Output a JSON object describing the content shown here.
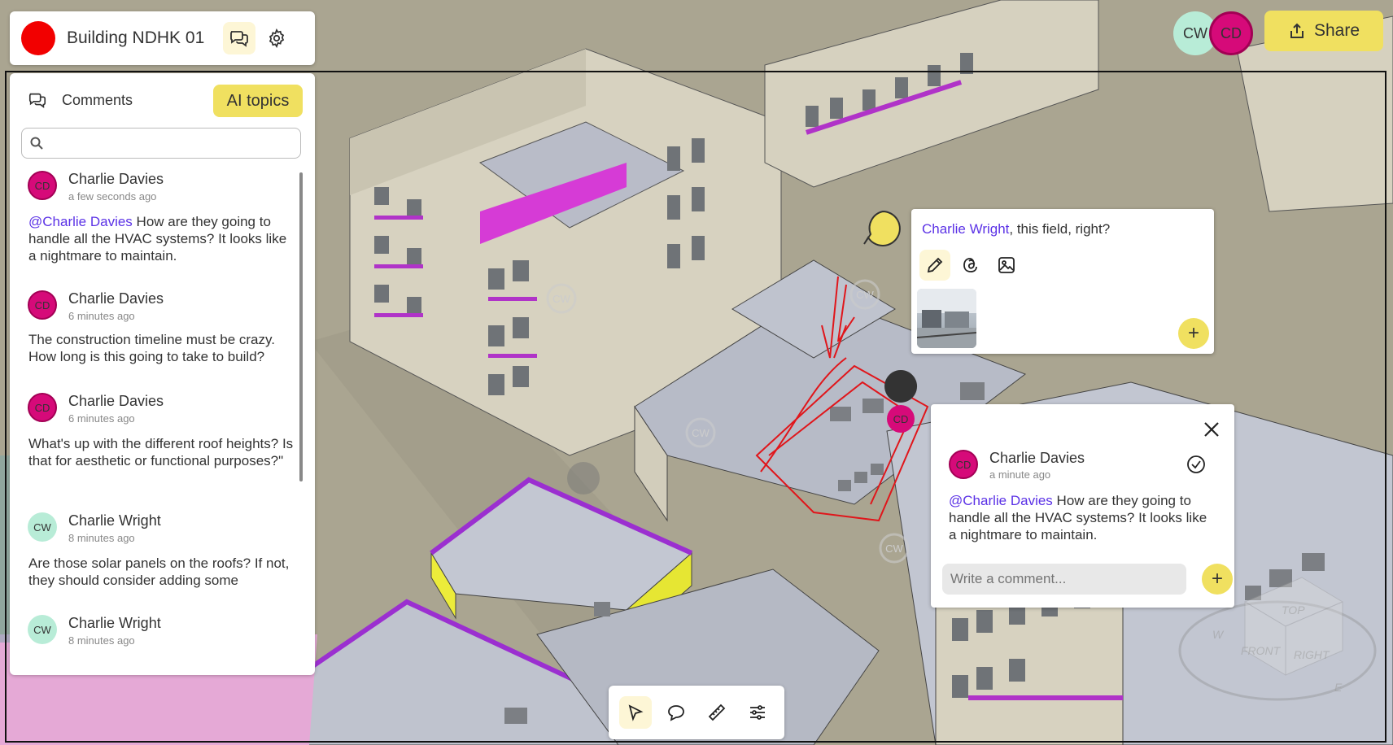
{
  "header": {
    "project_title": "Building NDHK 01",
    "icons": [
      "comments-icon",
      "gear-icon"
    ]
  },
  "top_bar": {
    "avatars": [
      {
        "initials": "CW",
        "color": "#b8ecd7"
      },
      {
        "initials": "CD",
        "color": "#d60a79"
      }
    ],
    "share_label": "Share"
  },
  "comments_panel": {
    "title": "Comments",
    "ai_topics_label": "AI topics",
    "search_placeholder": "",
    "items": [
      {
        "initials": "CD",
        "author": "Charlie Davies",
        "time": "a few seconds ago",
        "mention": "@Charlie Davies",
        "text": " How are they going to handle all the HVAC systems? It looks like a nightmare to maintain."
      },
      {
        "initials": "CD",
        "author": "Charlie Davies",
        "time": "6 minutes ago",
        "mention": "",
        "text": "The construction timeline must be crazy. How long is this going to take to build?"
      },
      {
        "initials": "CD",
        "author": "Charlie Davies",
        "time": "6 minutes ago",
        "mention": "",
        "text": "What's up with the different roof heights? Is that for aesthetic or functional purposes?\""
      },
      {
        "initials": "CW",
        "author": "Charlie Wright",
        "time": "8 minutes ago",
        "mention": "",
        "text": "Are those solar panels on the roofs? If not, they should consider adding some"
      },
      {
        "initials": "CW",
        "author": "Charlie Wright",
        "time": "8 minutes ago",
        "mention": "",
        "text": ""
      }
    ]
  },
  "field_popup": {
    "mention": "Charlie Wright",
    "text": ", this field, right?",
    "tools": [
      "pencil-icon",
      "threads-icon",
      "image-icon"
    ],
    "add_label": "+"
  },
  "thread_popup": {
    "initials": "CD",
    "author": "Charlie Davies",
    "time": "a minute ago",
    "mention": "@Charlie Davies",
    "text": " How are they going to handle all the HVAC systems? It looks like a nightmare to maintain.",
    "reply_placeholder": "Write a comment...",
    "add_label": "+"
  },
  "markers": [
    {
      "initials": "CW"
    },
    {
      "initials": "CW"
    },
    {
      "initials": "CW"
    },
    {
      "initials": "CD"
    }
  ],
  "bottom_toolbar": {
    "tools": [
      "select-cursor-icon",
      "comment-icon",
      "ruler-icon",
      "settings-sliders-icon"
    ]
  },
  "view_cube": {
    "top": "TOP",
    "front": "FRONT",
    "right": "RIGHT",
    "w": "W",
    "e": "E"
  },
  "colors": {
    "accent": "#f0e060",
    "mention": "#5b32e6",
    "brand": "#f20000",
    "sketch": "#e0161b"
  }
}
